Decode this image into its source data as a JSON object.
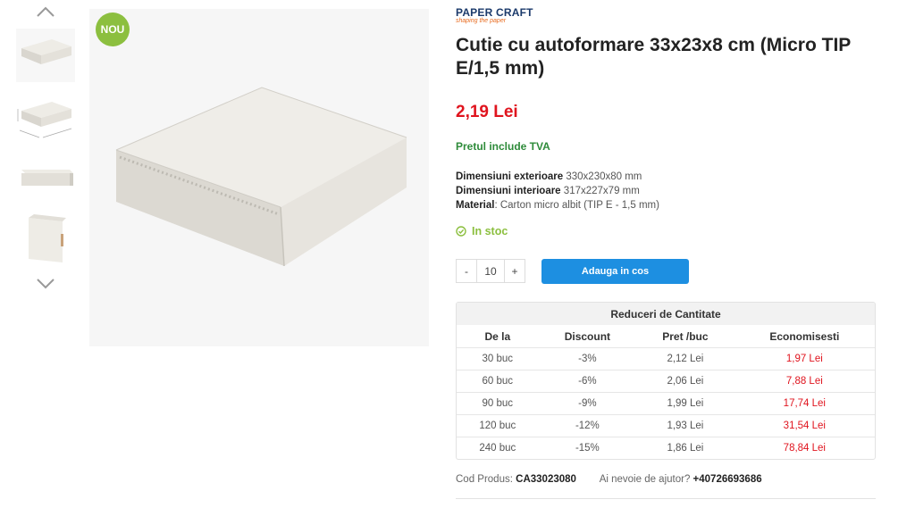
{
  "badge": "NOU",
  "brand": {
    "name": "PAPER CRAFT",
    "tagline": "shaping the paper"
  },
  "product": {
    "title": "Cutie cu autoformare 33x23x8 cm (Micro TIP E/1,5 mm)",
    "price": "2,19 Lei",
    "vat_note": "Pretul include TVA",
    "specs": [
      {
        "label": "Dimensiuni exterioare",
        "value": "330x230x80 mm"
      },
      {
        "label": "Dimensiuni interioare",
        "value": "317x227x79 mm"
      },
      {
        "label": "Material",
        "value": "Carton micro albit (TIP E - 1,5 mm)"
      }
    ],
    "stock": "In stoc"
  },
  "cart": {
    "minus": "-",
    "quantity": "10",
    "plus": "+",
    "add_label": "Adauga in cos"
  },
  "discounts": {
    "title": "Reduceri de Cantitate",
    "headers": [
      "De la",
      "Discount",
      "Pret /buc",
      "Economisesti"
    ],
    "rows": [
      [
        "30 buc",
        "-3%",
        "2,12 Lei",
        "1,97 Lei"
      ],
      [
        "60 buc",
        "-6%",
        "2,06 Lei",
        "7,88 Lei"
      ],
      [
        "90 buc",
        "-9%",
        "1,99 Lei",
        "17,74 Lei"
      ],
      [
        "120 buc",
        "-12%",
        "1,93 Lei",
        "31,54 Lei"
      ],
      [
        "240 buc",
        "-15%",
        "1,86 Lei",
        "78,84 Lei"
      ]
    ]
  },
  "footer": {
    "code_label": "Cod Produs:",
    "code_value": "CA33023080",
    "help_label": "Ai nevoie de ajutor?",
    "help_phone": "+40726693686"
  },
  "colors": {
    "price": "#e0141e",
    "vat": "#2e8b3a",
    "stock": "#8cbf3f",
    "button": "#1d8fe1",
    "badge": "#8cbf3f"
  },
  "icons": [
    "chevron-up-icon",
    "chevron-down-icon",
    "check-circle-icon"
  ]
}
